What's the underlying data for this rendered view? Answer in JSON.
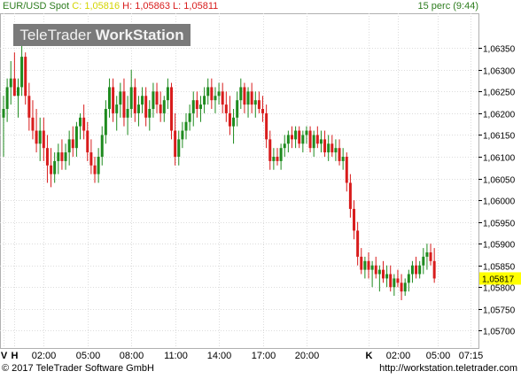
{
  "header": {
    "symbol": "EUR/USD Spot",
    "close_label": "C:",
    "close_value": "1,05816",
    "high_label": "H:",
    "high_value": "1,05863",
    "low_label": "L:",
    "low_value": "1,05811",
    "interval": "15 perc (9:44)"
  },
  "watermark": {
    "part1": "TeleTrader",
    "part2": "WorkStation"
  },
  "footer": {
    "copyright": "© 2017 TeleTrader Software GmbH",
    "url": "http://workstation.teletrader.com"
  },
  "colors": {
    "up": "#1f8b1f",
    "down": "#d81c1c",
    "last_label": "#ffff00",
    "header_close": "#d4d400"
  },
  "chart_data": {
    "type": "candlestick",
    "title": "EUR/USD Spot",
    "ylim": [
      1.0566,
      1.0643
    ],
    "yticks": [
      "1,06350",
      "1,06300",
      "1,06250",
      "1,06200",
      "1,06150",
      "1,06100",
      "1,06050",
      "1,06000",
      "1,05950",
      "1,05900",
      "1,05850",
      "1,05800",
      "1,05750",
      "1,05700"
    ],
    "ytick_values": [
      1.0635,
      1.063,
      1.0625,
      1.062,
      1.0615,
      1.061,
      1.0605,
      1.06,
      1.0595,
      1.059,
      1.0585,
      1.058,
      1.0575,
      1.057
    ],
    "xticks": [
      {
        "label": "V",
        "bar": 0
      },
      {
        "label": "H",
        "bar": 3
      },
      {
        "label": "02:00",
        "bar": 11
      },
      {
        "label": "05:00",
        "bar": 23
      },
      {
        "label": "08:00",
        "bar": 35
      },
      {
        "label": "11:00",
        "bar": 47
      },
      {
        "label": "14:00",
        "bar": 59
      },
      {
        "label": "17:00",
        "bar": 71
      },
      {
        "label": "20:00",
        "bar": 83
      },
      {
        "label": "K",
        "bar": 100
      },
      {
        "label": "02:00",
        "bar": 108
      },
      {
        "label": "05:00",
        "bar": 119
      },
      {
        "label": "07:15",
        "bar": 128
      }
    ],
    "last_value": "1,05817",
    "grid": true,
    "series": [
      {
        "ohlc": [
          [
            1.0619,
            1.0624,
            1.061,
            1.0621
          ],
          [
            1.0621,
            1.0628,
            1.0618,
            1.0626
          ],
          [
            1.0626,
            1.0632,
            1.0622,
            1.0628
          ],
          [
            1.0628,
            1.0634,
            1.0624,
            1.0624
          ],
          [
            1.0624,
            1.0628,
            1.0619,
            1.0626
          ],
          [
            1.0626,
            1.0636,
            1.0624,
            1.0633
          ],
          [
            1.0633,
            1.0634,
            1.0622,
            1.0624
          ],
          [
            1.0624,
            1.0627,
            1.0616,
            1.0619
          ],
          [
            1.0619,
            1.0623,
            1.0614,
            1.0616
          ],
          [
            1.0616,
            1.0621,
            1.0611,
            1.0613
          ],
          [
            1.0613,
            1.0619,
            1.0609,
            1.0616
          ],
          [
            1.0616,
            1.0619,
            1.0609,
            1.0612
          ],
          [
            1.0612,
            1.0615,
            1.0604,
            1.0608
          ],
          [
            1.0608,
            1.0612,
            1.0603,
            1.0606
          ],
          [
            1.0606,
            1.0611,
            1.0604,
            1.0609
          ],
          [
            1.0609,
            1.0613,
            1.0606,
            1.0611
          ],
          [
            1.0611,
            1.0614,
            1.0607,
            1.0609
          ],
          [
            1.0609,
            1.0613,
            1.0607,
            1.0611
          ],
          [
            1.0611,
            1.0616,
            1.0608,
            1.0614
          ],
          [
            1.0614,
            1.0617,
            1.061,
            1.0612
          ],
          [
            1.0612,
            1.0618,
            1.061,
            1.0617
          ],
          [
            1.0617,
            1.062,
            1.0614,
            1.0619
          ],
          [
            1.0619,
            1.0622,
            1.0614,
            1.0616
          ],
          [
            1.0616,
            1.0618,
            1.0609,
            1.0611
          ],
          [
            1.0611,
            1.0614,
            1.0606,
            1.0608
          ],
          [
            1.0608,
            1.061,
            1.0604,
            1.0606
          ],
          [
            1.0606,
            1.0612,
            1.0604,
            1.061
          ],
          [
            1.061,
            1.0617,
            1.0608,
            1.0615
          ],
          [
            1.0615,
            1.0623,
            1.0613,
            1.0621
          ],
          [
            1.0621,
            1.0628,
            1.0619,
            1.0626
          ],
          [
            1.0626,
            1.0628,
            1.0618,
            1.062
          ],
          [
            1.062,
            1.0624,
            1.0616,
            1.0622
          ],
          [
            1.0622,
            1.0627,
            1.0619,
            1.0625
          ],
          [
            1.0625,
            1.0628,
            1.0617,
            1.0619
          ],
          [
            1.0619,
            1.0624,
            1.0615,
            1.0621
          ],
          [
            1.0621,
            1.063,
            1.0619,
            1.0626
          ],
          [
            1.0626,
            1.0628,
            1.0618,
            1.062
          ],
          [
            1.062,
            1.0624,
            1.0617,
            1.0622
          ],
          [
            1.0622,
            1.0626,
            1.062,
            1.0624
          ],
          [
            1.0624,
            1.0626,
            1.0617,
            1.0619
          ],
          [
            1.0619,
            1.0623,
            1.0616,
            1.0621
          ],
          [
            1.0621,
            1.0627,
            1.0619,
            1.0625
          ],
          [
            1.0625,
            1.0627,
            1.062,
            1.0622
          ],
          [
            1.0622,
            1.0625,
            1.0618,
            1.062
          ],
          [
            1.062,
            1.0624,
            1.0618,
            1.0623
          ],
          [
            1.0623,
            1.0628,
            1.0621,
            1.0626
          ],
          [
            1.0626,
            1.0627,
            1.0614,
            1.0616
          ],
          [
            1.0616,
            1.062,
            1.0608,
            1.061
          ],
          [
            1.061,
            1.0616,
            1.0608,
            1.0614
          ],
          [
            1.0614,
            1.0618,
            1.0612,
            1.0616
          ],
          [
            1.0616,
            1.062,
            1.0614,
            1.0618
          ],
          [
            1.0618,
            1.0622,
            1.0616,
            1.062
          ],
          [
            1.062,
            1.0625,
            1.0617,
            1.0623
          ],
          [
            1.0623,
            1.0625,
            1.0619,
            1.0621
          ],
          [
            1.0621,
            1.0624,
            1.0618,
            1.0622
          ],
          [
            1.0622,
            1.0626,
            1.062,
            1.0624
          ],
          [
            1.0624,
            1.0628,
            1.0622,
            1.0626
          ],
          [
            1.0626,
            1.0628,
            1.0621,
            1.0623
          ],
          [
            1.0623,
            1.0626,
            1.062,
            1.0624
          ],
          [
            1.0624,
            1.0627,
            1.0622,
            1.0625
          ],
          [
            1.0625,
            1.0627,
            1.062,
            1.0622
          ],
          [
            1.0622,
            1.0625,
            1.0618,
            1.062
          ],
          [
            1.062,
            1.0624,
            1.0615,
            1.0617
          ],
          [
            1.0617,
            1.0621,
            1.0613,
            1.0619
          ],
          [
            1.0619,
            1.0625,
            1.0617,
            1.0623
          ],
          [
            1.0623,
            1.0628,
            1.0621,
            1.0626
          ],
          [
            1.0626,
            1.0627,
            1.062,
            1.0622
          ],
          [
            1.0622,
            1.0626,
            1.0619,
            1.0625
          ],
          [
            1.0625,
            1.0627,
            1.062,
            1.0622
          ],
          [
            1.0622,
            1.0625,
            1.0619,
            1.0623
          ],
          [
            1.0623,
            1.0625,
            1.062,
            1.0621
          ],
          [
            1.0621,
            1.0624,
            1.0618,
            1.062
          ],
          [
            1.062,
            1.0622,
            1.0612,
            1.0614
          ],
          [
            1.0614,
            1.0616,
            1.0607,
            1.0609
          ],
          [
            1.0609,
            1.0612,
            1.0607,
            1.061
          ],
          [
            1.061,
            1.0612,
            1.0608,
            1.0609
          ],
          [
            1.0609,
            1.0613,
            1.0607,
            1.0612
          ],
          [
            1.0612,
            1.0615,
            1.061,
            1.0613
          ],
          [
            1.0613,
            1.0616,
            1.0611,
            1.0615
          ],
          [
            1.0615,
            1.0617,
            1.0612,
            1.0614
          ],
          [
            1.0614,
            1.0617,
            1.0612,
            1.0616
          ],
          [
            1.0616,
            1.0617,
            1.0612,
            1.0613
          ],
          [
            1.0613,
            1.0616,
            1.0611,
            1.0615
          ],
          [
            1.0615,
            1.0617,
            1.0613,
            1.0616
          ],
          [
            1.0616,
            1.0617,
            1.0611,
            1.0612
          ],
          [
            1.0612,
            1.0616,
            1.061,
            1.0615
          ],
          [
            1.0615,
            1.0617,
            1.0612,
            1.0613
          ],
          [
            1.0613,
            1.0616,
            1.0611,
            1.0614
          ],
          [
            1.0614,
            1.0616,
            1.061,
            1.0611
          ],
          [
            1.0611,
            1.0615,
            1.0609,
            1.0613
          ],
          [
            1.0613,
            1.0615,
            1.061,
            1.0611
          ],
          [
            1.0611,
            1.0614,
            1.0609,
            1.0612
          ],
          [
            1.0612,
            1.0614,
            1.0608,
            1.0609
          ],
          [
            1.0609,
            1.0612,
            1.0607,
            1.061
          ],
          [
            1.061,
            1.0611,
            1.0602,
            1.0604
          ],
          [
            1.0604,
            1.0606,
            1.0596,
            1.0598
          ],
          [
            1.0598,
            1.06,
            1.0591,
            1.0593
          ],
          [
            1.0593,
            1.0595,
            1.0585,
            1.0587
          ],
          [
            1.0587,
            1.0589,
            1.0583,
            1.0584
          ],
          [
            1.0584,
            1.0587,
            1.0582,
            1.0586
          ],
          [
            1.0586,
            1.0588,
            1.0582,
            1.0584
          ],
          [
            1.0584,
            1.0586,
            1.058,
            1.0585
          ],
          [
            1.0585,
            1.0587,
            1.0582,
            1.0583
          ],
          [
            1.0583,
            1.0585,
            1.0579,
            1.0584
          ],
          [
            1.0584,
            1.0586,
            1.0581,
            1.0582
          ],
          [
            1.0582,
            1.0585,
            1.058,
            1.0583
          ],
          [
            1.0583,
            1.0585,
            1.0579,
            1.058
          ],
          [
            1.058,
            1.0583,
            1.0578,
            1.0582
          ],
          [
            1.0582,
            1.0584,
            1.058,
            1.0581
          ],
          [
            1.0581,
            1.0583,
            1.0577,
            1.0579
          ],
          [
            1.0579,
            1.0582,
            1.0578,
            1.0581
          ],
          [
            1.0581,
            1.0584,
            1.0579,
            1.0583
          ],
          [
            1.0583,
            1.0586,
            1.0581,
            1.0585
          ],
          [
            1.0585,
            1.0587,
            1.0582,
            1.0583
          ],
          [
            1.0583,
            1.0586,
            1.0582,
            1.0585
          ],
          [
            1.0585,
            1.0589,
            1.0583,
            1.0587
          ],
          [
            1.0587,
            1.059,
            1.0584,
            1.0588
          ],
          [
            1.0588,
            1.059,
            1.0585,
            1.0586
          ],
          [
            1.0586,
            1.0589,
            1.0581,
            1.0582
          ]
        ]
      }
    ]
  }
}
